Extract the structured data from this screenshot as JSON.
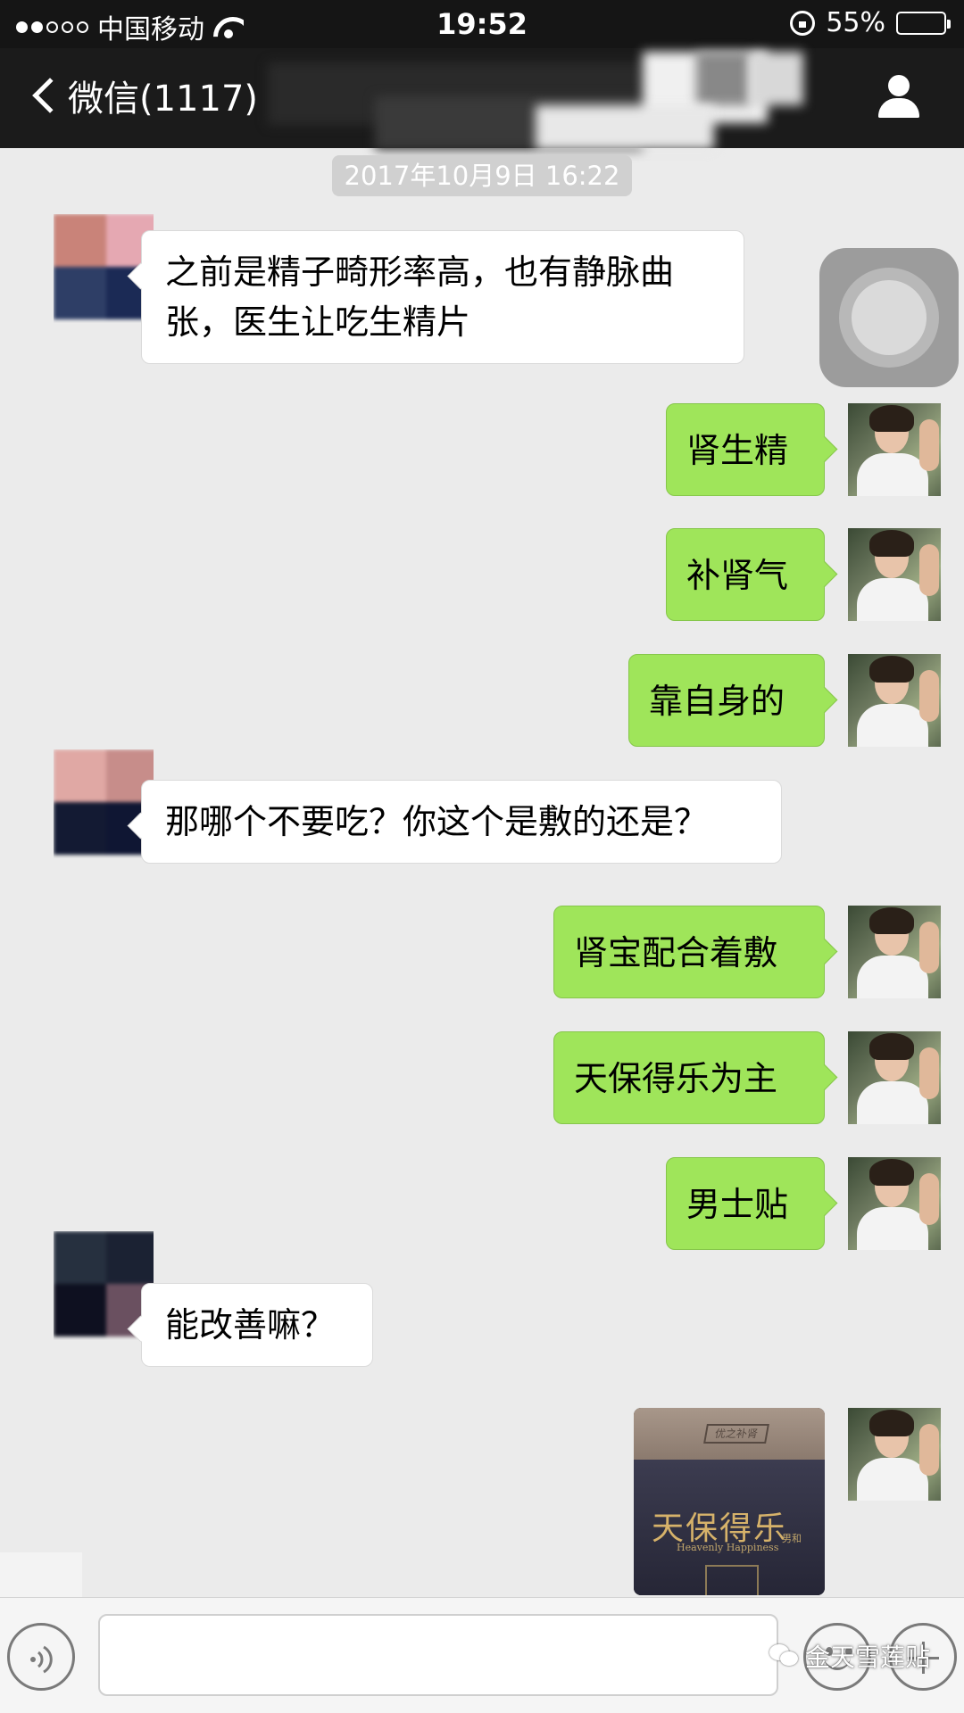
{
  "status_bar": {
    "carrier": "中国移动",
    "time": "19:52",
    "battery": "55%",
    "battery_level": 0.55
  },
  "nav": {
    "back_label": "微信(1117)"
  },
  "timestamp": "2017年10月9日 16:22",
  "messages": [
    {
      "side": "left",
      "text": "之前是精子畸形率高，也有静脉曲张，医生让吃生精片"
    },
    {
      "side": "right",
      "text": "肾生精"
    },
    {
      "side": "right",
      "text": "补肾气"
    },
    {
      "side": "right",
      "text": "靠自身的"
    },
    {
      "side": "left",
      "text": "那哪个不要吃？你这个是敷的还是？"
    },
    {
      "side": "right",
      "text": "肾宝配合着敷"
    },
    {
      "side": "right",
      "text": "天保得乐为主"
    },
    {
      "side": "right",
      "text": "男士贴"
    },
    {
      "side": "left",
      "text": "能改善嘛？"
    }
  ],
  "product_image": {
    "box_label": "优之补肾",
    "brand": "天保得乐",
    "subtitle": "Heavenly Happiness",
    "tag": "男和"
  },
  "input": {
    "value": "",
    "placeholder": ""
  },
  "watermark": "金天雪莲贴",
  "colors": {
    "chat_bg": "#ebebeb",
    "sent_bubble": "#9fe55a",
    "received_bubble": "#ffffff",
    "nav_bg": "#1b1b1b"
  }
}
